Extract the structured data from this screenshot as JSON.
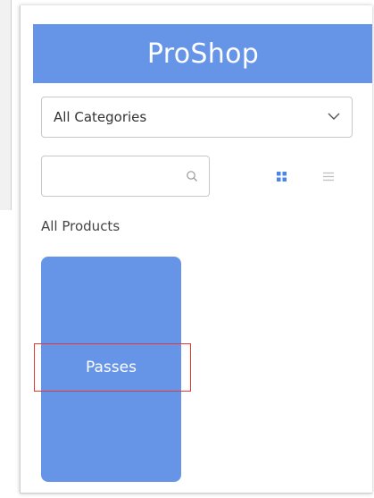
{
  "header": {
    "title": "ProShop"
  },
  "filters": {
    "category_selected": "All Categories",
    "search_value": "",
    "view_modes": [
      "grid",
      "list"
    ],
    "active_view": "grid"
  },
  "catalog": {
    "section_label": "All Products",
    "products": [
      {
        "name": "Passes"
      }
    ]
  },
  "colors": {
    "brand": "#6695e8",
    "highlight": "#e53935",
    "active_icon": "#4a86e8",
    "inactive_icon": "#c0c0c0"
  },
  "icons": [
    "chevron-down-icon",
    "search-icon",
    "grid-view-icon",
    "list-view-icon"
  ]
}
